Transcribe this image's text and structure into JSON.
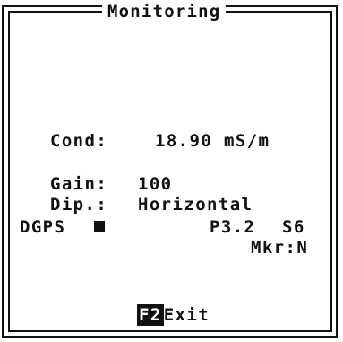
{
  "window": {
    "title": "Monitoring"
  },
  "readings": {
    "cond_label": "Cond:",
    "cond_value": "18.90 mS/m",
    "gain_label": "Gain:",
    "gain_value": "100",
    "dip_label": "Dip.:",
    "dip_value": "Horizontal",
    "dgps_label": "DGPS",
    "p_value": "P3.2",
    "s_value": "S6",
    "marker": "Mkr:N"
  },
  "footer": {
    "key": "F2",
    "action": "Exit"
  }
}
